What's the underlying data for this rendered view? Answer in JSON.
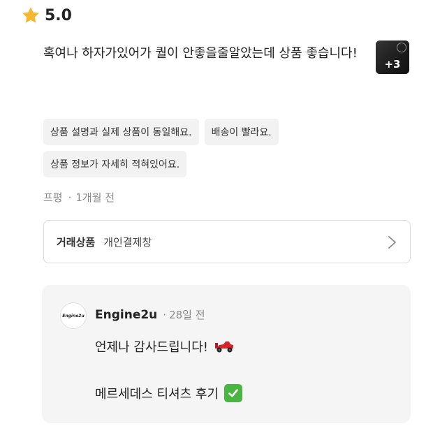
{
  "rating": {
    "value": "5.0",
    "icon": "star-icon",
    "color": "#F5B82E"
  },
  "review": {
    "text": "혹여나 하자가있어가 퀄이 안좋을줄알았는데 상품 좋습니다!",
    "thumbnail": {
      "more_count": "+3"
    }
  },
  "tags": [
    {
      "label": "상품 설명과 실제 상품이 동일해요."
    },
    {
      "label": "배송이 빨라요."
    },
    {
      "label": "상품 정보가 자세히 적혀있어요."
    }
  ],
  "meta": {
    "author": "프평",
    "separator": "·",
    "time": "1개월 전"
  },
  "product": {
    "label": "거래상품",
    "name": "개인결제창"
  },
  "reply": {
    "seller_name": "Engine2u",
    "separator": "·",
    "time": "28일 전",
    "avatar_text": "Engine2u",
    "line1": "언제나 감사드립니다!",
    "line2": "메르세데스 티셔츠 후기"
  },
  "colors": {
    "tag_bg": "#F2F2F2",
    "reply_bg": "#F5F5F5",
    "check_green": "#4BB543"
  }
}
